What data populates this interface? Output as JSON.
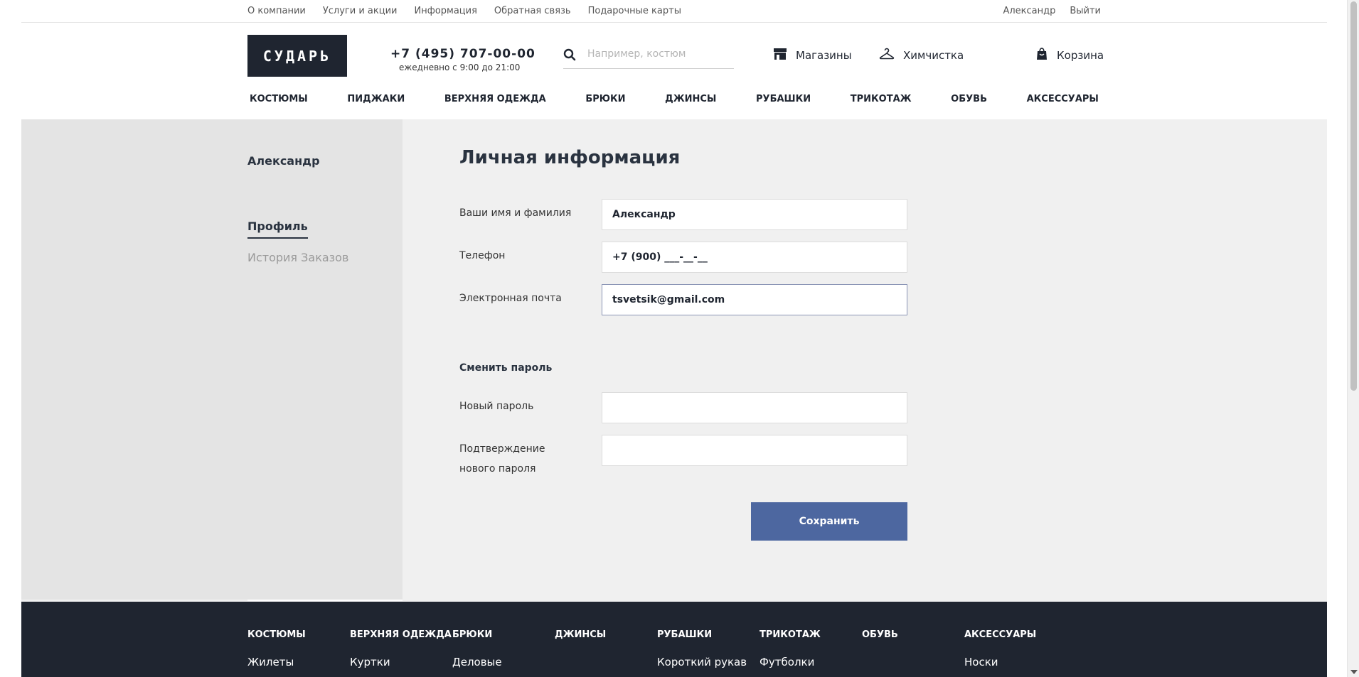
{
  "top_links": {
    "left": [
      "О компании",
      "Услуги и акции",
      "Информация",
      "Обратная связь",
      "Подарочные карты"
    ],
    "user": "Александр",
    "logout": "Выйти"
  },
  "header": {
    "logo": "СУДАРЬ",
    "phone": "+7 (495) 707-00-00",
    "hours": "ежедневно с 9:00 до 21:00",
    "search_placeholder": "Например, костюм",
    "stores": "Магазины",
    "dry_cleaning": "Химчистка",
    "cart": "Корзина"
  },
  "nav": [
    "КОСТЮМЫ",
    "ПИДЖАКИ",
    "ВЕРХНЯЯ ОДЕЖДА",
    "БРЮКИ",
    "ДЖИНСЫ",
    "РУБАШКИ",
    "ТРИКОТАЖ",
    "ОБУВЬ",
    "АКСЕССУАРЫ"
  ],
  "sidebar": {
    "user_name": "Александр",
    "profile": "Профиль",
    "order_history": "История Заказов"
  },
  "form": {
    "title": "Личная информация",
    "name_label": "Ваши имя и фамилия",
    "name_value": "Александр",
    "phone_label": "Телефон",
    "phone_value": "+7 (900) ___-__-__",
    "email_label": "Электронная почта",
    "email_value": "tsvetsik@gmail.com",
    "change_password": "Сменить пароль",
    "new_password_label": "Новый пароль",
    "new_password_value": "",
    "confirm_label": "Подтверждение нового пароля",
    "confirm_value": "",
    "save": "Сохранить"
  },
  "footer": {
    "columns": [
      {
        "heading": "КОСТЮМЫ",
        "first_item": "Жилеты"
      },
      {
        "heading": "ВЕРХНЯЯ ОДЕЖДА",
        "first_item": "Куртки"
      },
      {
        "heading": "БРЮКИ",
        "first_item": "Деловые"
      },
      {
        "heading": "ДЖИНСЫ",
        "first_item": ""
      },
      {
        "heading": "РУБАШКИ",
        "first_item": "Короткий рукав"
      },
      {
        "heading": "ТРИКОТАЖ",
        "first_item": "Футболки"
      },
      {
        "heading": "ОБУВЬ",
        "first_item": ""
      },
      {
        "heading": "АКСЕССУАРЫ",
        "first_item": "Носки"
      }
    ]
  },
  "colors": {
    "dark": "#1f2530",
    "accent": "#4d67a0",
    "page_bg": "#f0f0f0",
    "sidebar_bg": "#e4e4e4"
  },
  "icons": {
    "search": "search-icon",
    "stores": "store-icon",
    "dry_cleaning": "hanger-icon",
    "cart": "bag-icon"
  }
}
